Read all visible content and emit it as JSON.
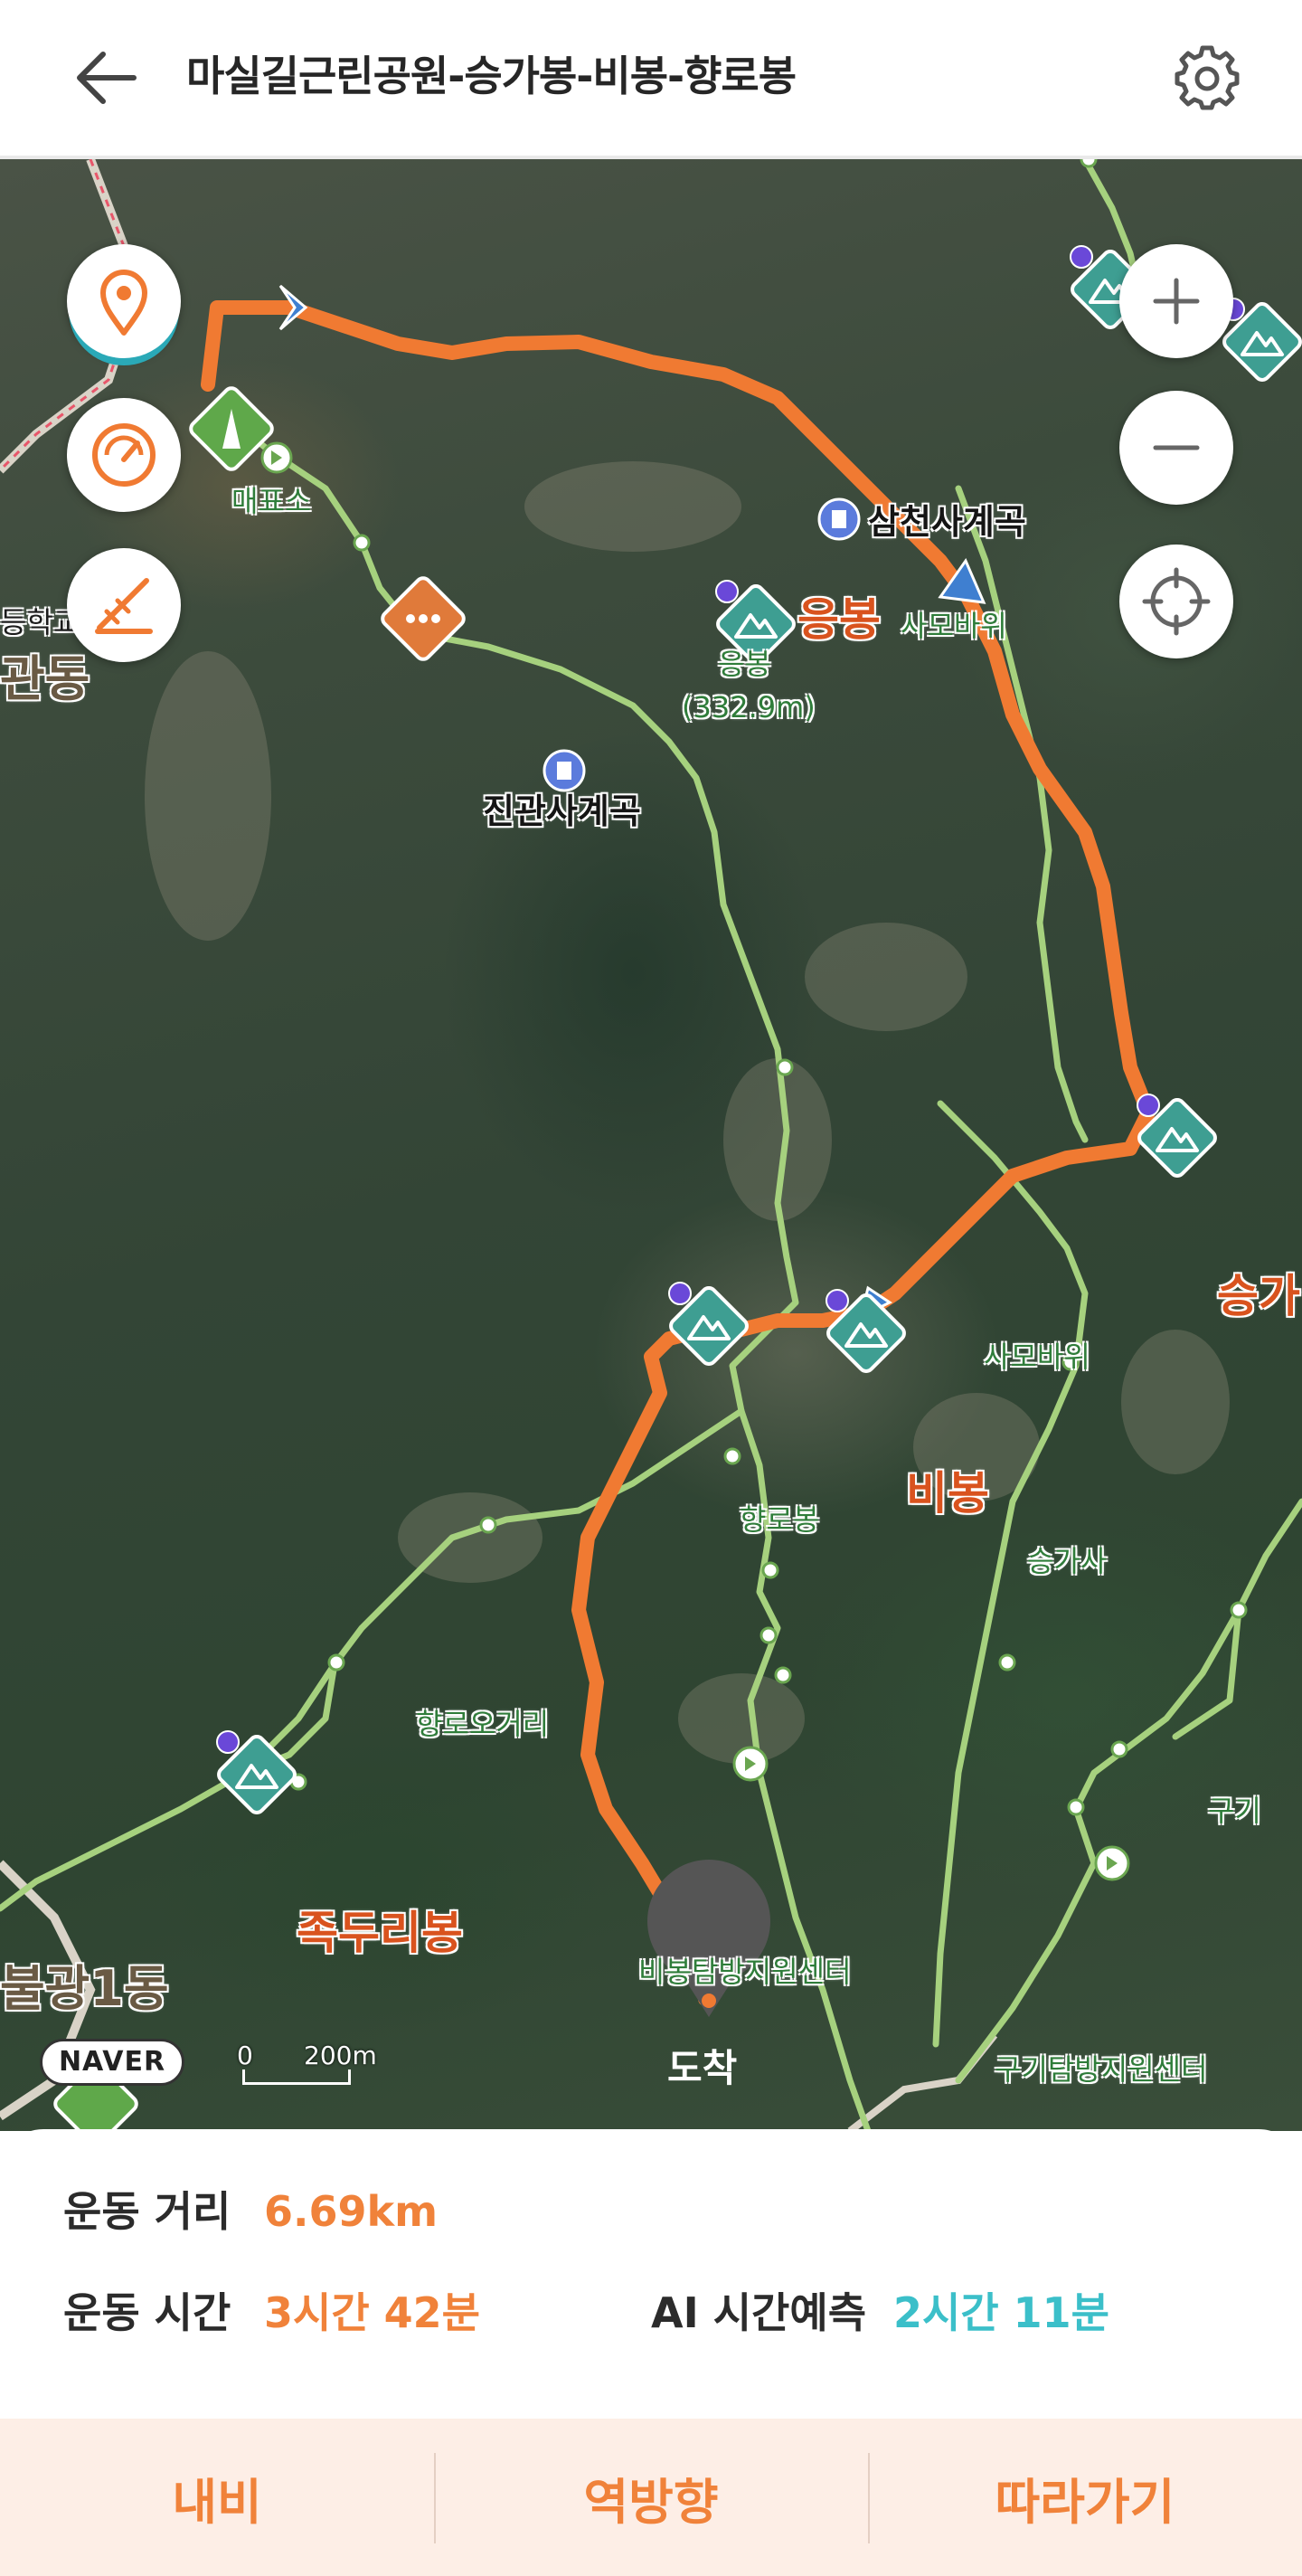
{
  "header": {
    "title": "마실길근린공원-승가봉-비봉-향로봉",
    "back_icon": "arrow-left-icon",
    "settings_icon": "gear-icon"
  },
  "map": {
    "peaks": [
      {
        "name": "응봉"
      },
      {
        "name": "승가"
      },
      {
        "name": "비봉"
      },
      {
        "name": "족두리봉"
      }
    ],
    "labels": {
      "jingwan_valley": "진관사계곡",
      "samcheon_valley": "삼천사계곡",
      "eungbong_small": "응봉",
      "eungbong_height": "(332.9m)",
      "maepyoso": "매표소",
      "samobawi_top": "사모바위",
      "samobawi": "사모바위",
      "hyangnobong": "향로봉",
      "seungasa": "승가사",
      "hyangno_ogeori": "향로오거리",
      "bibong_center": "비봉탐방지원센터",
      "gugi_center": "구기탐방지원센터",
      "gugi": "구기",
      "dong_left": "관동",
      "bulgwang": "불광1동",
      "school": "등학교",
      "arrival": "도착"
    },
    "naver_logo": "NAVER",
    "scale_zero": "0",
    "scale_distance": "200m",
    "buttons": {
      "zoom_in_icon": "plus-icon",
      "zoom_out_icon": "minus-icon",
      "locate_icon": "crosshair-icon",
      "location_pin_icon": "location-pin-icon",
      "speed_icon": "speedometer-icon",
      "elevation_icon": "elevation-icon"
    },
    "colors": {
      "route": "#f07a32",
      "trail": "#9ccc75",
      "peak_marker": "#3e9e92"
    }
  },
  "stats": {
    "distance_label": "운동 거리",
    "distance_value": "6.69km",
    "time_label": "운동 시간",
    "time_value": "3시간 42분",
    "ai_label": "AI 시간예측",
    "ai_value": "2시간 11분"
  },
  "actions": {
    "navi": "내비",
    "reverse": "역방향",
    "follow": "따라가기"
  },
  "colors": {
    "accent_orange": "#f0823a",
    "accent_teal": "#3bbfc9",
    "action_bar_bg": "#fdeee6"
  }
}
